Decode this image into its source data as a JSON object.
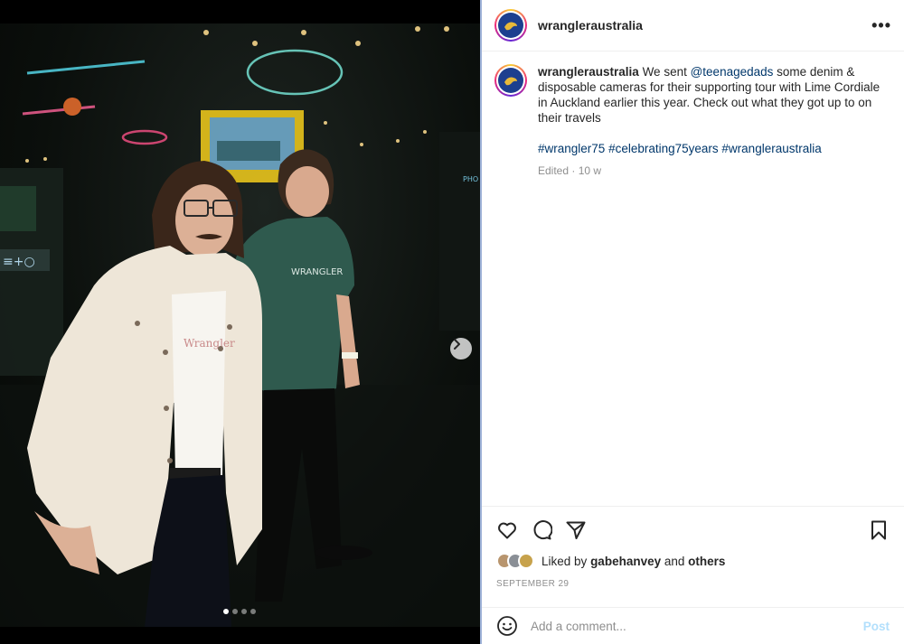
{
  "post": {
    "username": "wrangleraustralia",
    "more_icon": "more-horizontal-icon",
    "caption": {
      "username": "wrangleraustralia",
      "text_before": "We sent ",
      "mention": "@teenagedads",
      "text_after": " some denim & disposable cameras for their supporting tour with Lime Cordiale in Auckland earlier this year. Check out what they got up to on their travels",
      "hashtags": [
        "#wrangler75",
        "#celebrating75years",
        "#wrangleraustralia"
      ]
    },
    "meta": "Edited · 10 w",
    "actions": {
      "like_icon": "heart-icon",
      "comment_icon": "comment-icon",
      "share_icon": "share-icon",
      "save_icon": "bookmark-icon"
    },
    "likes": {
      "prefix": "Liked by ",
      "user": "gabehanvey",
      "middle": " and ",
      "others": "others"
    },
    "date": "SEPTEMBER 29",
    "comment": {
      "placeholder": "Add a comment...",
      "post_label": "Post"
    },
    "carousel": {
      "slide_count": 4,
      "active_index": 0
    }
  },
  "colors": {
    "link": "#00376b",
    "muted": "#8e8e8e",
    "post_disabled": "#b2dffc",
    "avatar_bg": "#1d3f8f"
  }
}
